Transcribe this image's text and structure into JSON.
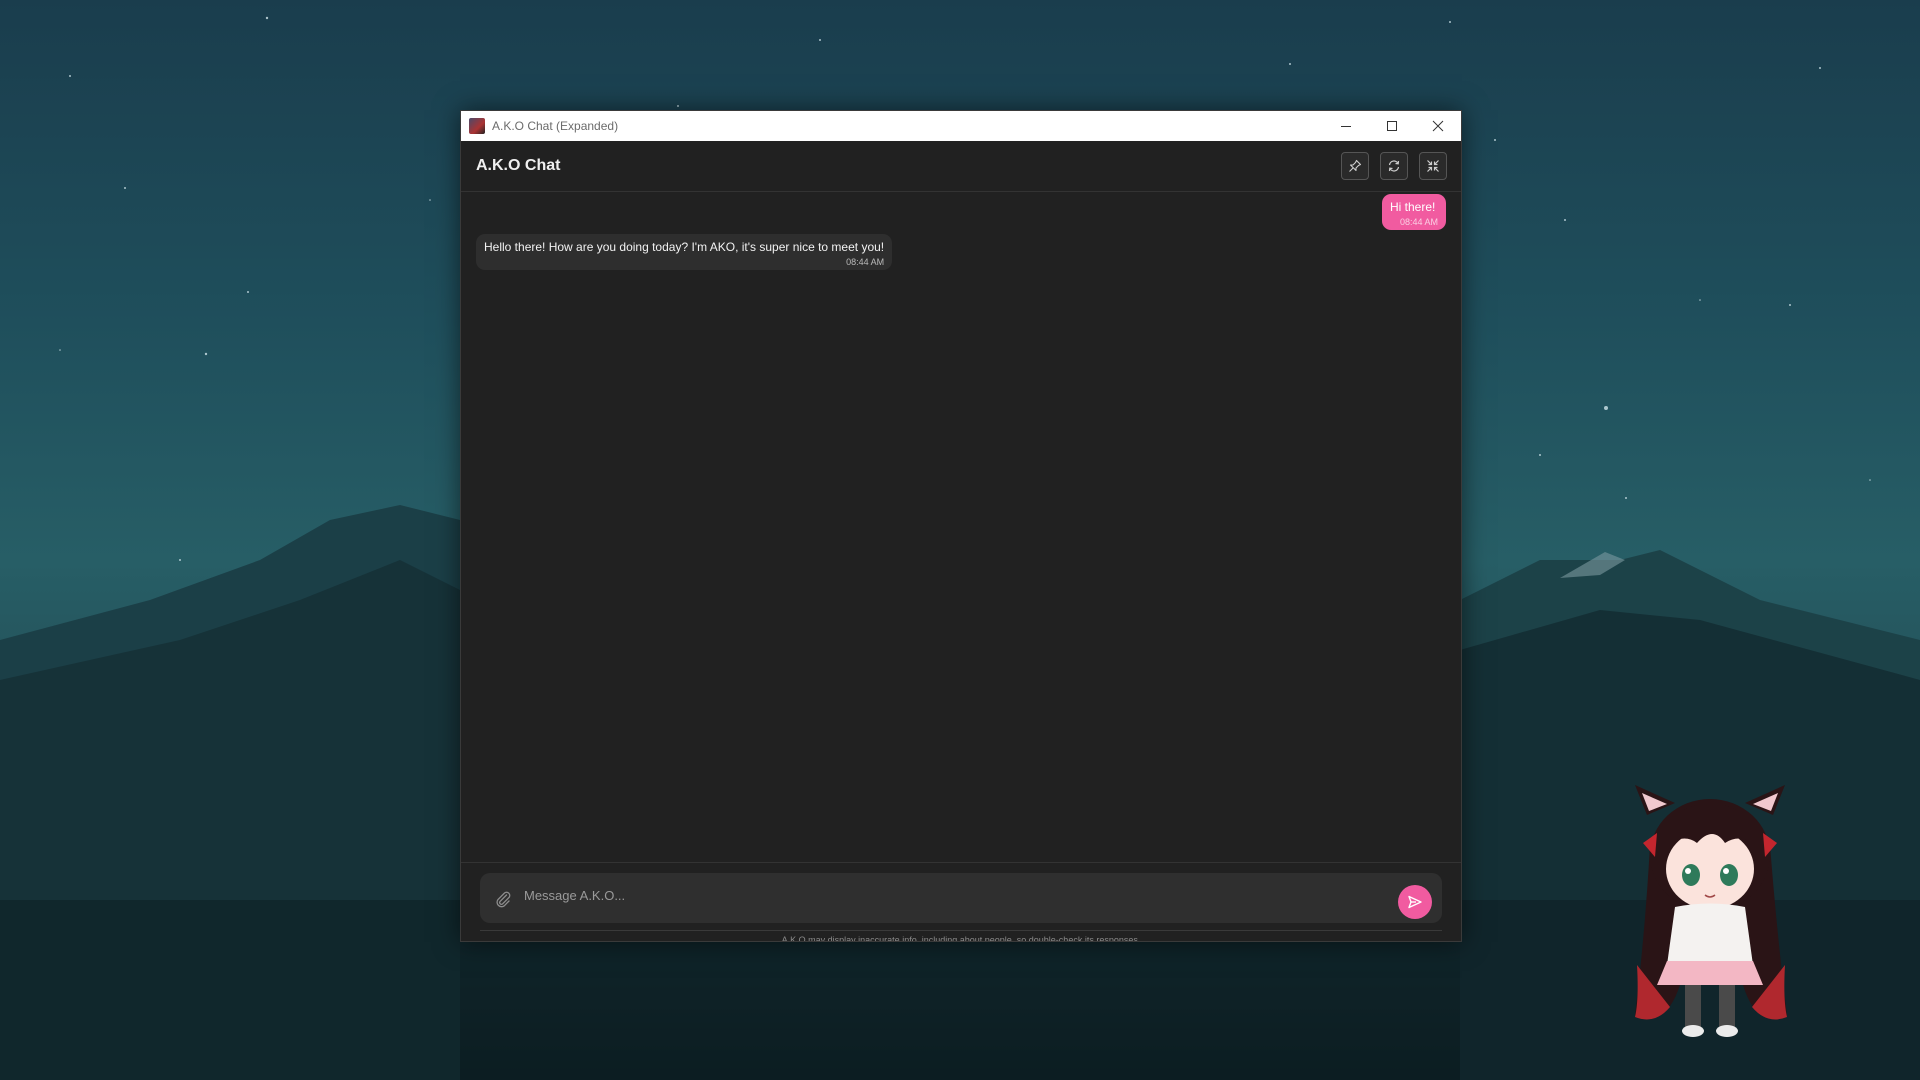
{
  "colors": {
    "accent": "#f15ba0",
    "window_bg": "#212121",
    "ai_bubble": "#2e2e2e",
    "input_bg": "#2f2f2f"
  },
  "window": {
    "title": "A.K.O Chat (Expanded)",
    "controls": [
      "minimize-icon",
      "maximize-icon",
      "close-icon"
    ]
  },
  "header": {
    "title": "A.K.O Chat",
    "actions": [
      "pin-icon",
      "refresh-icon",
      "collapse-icon"
    ]
  },
  "messages": [
    {
      "role": "user",
      "text": "Hi there!",
      "time": "08:44 AM"
    },
    {
      "role": "assistant",
      "text": "Hello there! How are you doing today? I'm AKO, it's super nice to meet you!",
      "time": "08:44 AM"
    }
  ],
  "composer": {
    "placeholder": "Message A.K.O...",
    "attach_icon": "paperclip-icon",
    "send_icon": "send-icon"
  },
  "disclaimer": "A.K.O may display inaccurate info, including about people, so double-check its responses."
}
